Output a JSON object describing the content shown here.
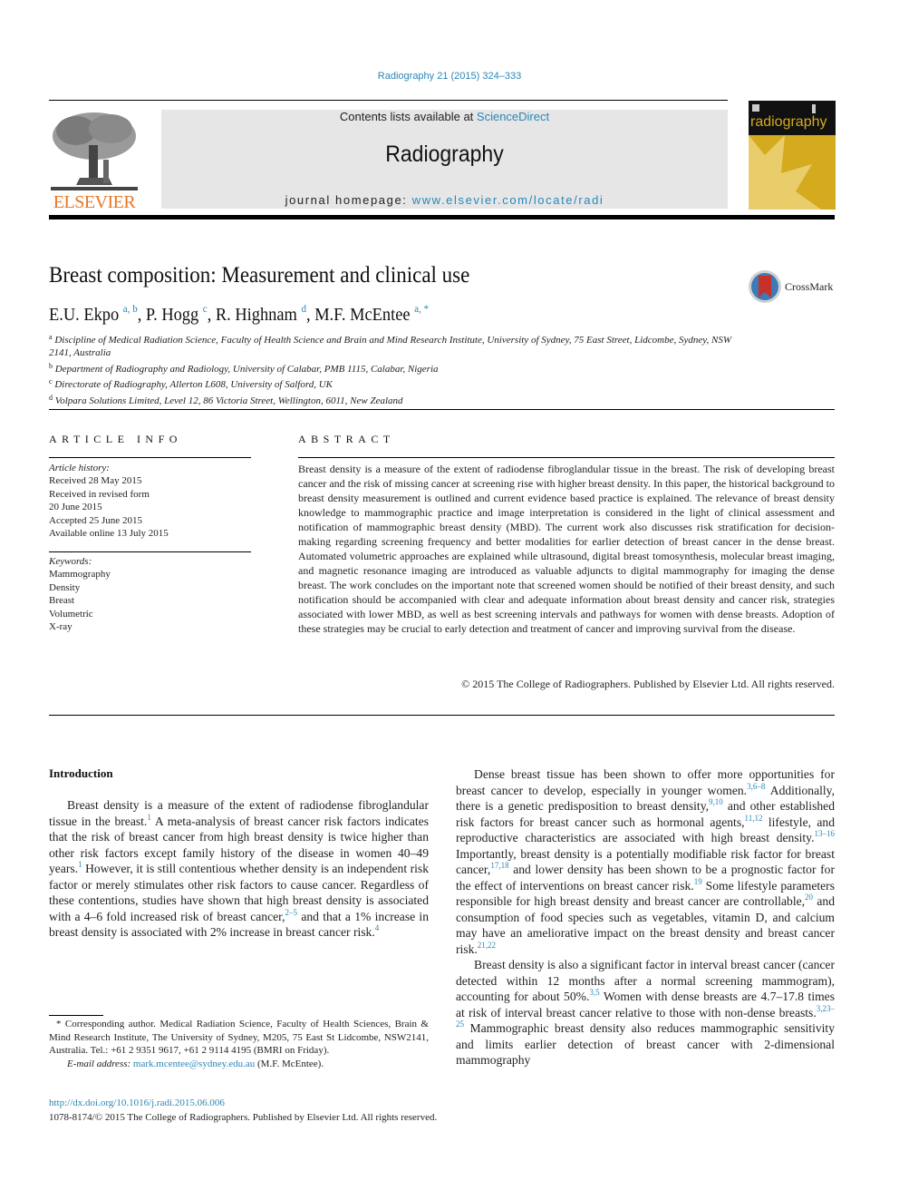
{
  "header": {
    "citation": "Radiography 21 (2015) 324–333",
    "contents_prefix": "Contents lists available at ",
    "contents_link": "ScienceDirect",
    "journal_name": "Radiography",
    "homepage_prefix": "journal homepage: ",
    "homepage_link": "www.elsevier.com/locate/radi",
    "publisher_logo_text": "ELSEVIER",
    "cover_title": "radiography",
    "crossmark_label": "CrossMark"
  },
  "article": {
    "title": "Breast composition: Measurement and clinical use",
    "authors": [
      {
        "name": "E.U. Ekpo",
        "affil": "a, b",
        "sep": ", "
      },
      {
        "name": "P. Hogg",
        "affil": "c",
        "sep": ", "
      },
      {
        "name": "R. Highnam",
        "affil": "d",
        "sep": ", "
      },
      {
        "name": "M.F. McEntee",
        "affil": "a, *",
        "sep": ""
      }
    ],
    "affiliations": [
      {
        "key": "a",
        "text": "Discipline of Medical Radiation Science, Faculty of Health Science and Brain and Mind Research Institute, University of Sydney, 75 East Street, Lidcombe, Sydney, NSW 2141, Australia"
      },
      {
        "key": "b",
        "text": "Department of Radiography and Radiology, University of Calabar, PMB 1115, Calabar, Nigeria"
      },
      {
        "key": "c",
        "text": "Directorate of Radiography, Allerton L608, University of Salford, UK"
      },
      {
        "key": "d",
        "text": "Volpara Solutions Limited, Level 12, 86 Victoria Street, Wellington, 6011, New Zealand"
      }
    ]
  },
  "article_info": {
    "heading": "ARTICLE INFO",
    "history_label": "Article history:",
    "history": [
      "Received 28 May 2015",
      "Received in revised form",
      "20 June 2015",
      "Accepted 25 June 2015",
      "Available online 13 July 2015"
    ],
    "keywords_label": "Keywords:",
    "keywords": [
      "Mammography",
      "Density",
      "Breast",
      "Volumetric",
      "X-ray"
    ]
  },
  "abstract": {
    "heading": "ABSTRACT",
    "text": "Breast density is a measure of the extent of radiodense fibroglandular tissue in the breast. The risk of developing breast cancer and the risk of missing cancer at screening rise with higher breast density. In this paper, the historical background to breast density measurement is outlined and current evidence based practice is explained. The relevance of breast density knowledge to mammographic practice and image interpretation is considered in the light of clinical assessment and notification of mammographic breast density (MBD). The current work also discusses risk stratification for decision-making regarding screening frequency and better modalities for earlier detection of breast cancer in the dense breast. Automated volumetric approaches are explained while ultrasound, digital breast tomosynthesis, mo­lecular breast imaging, and magnetic resonance imaging are introduced as valuable adjuncts to digital mammography for imaging the dense breast. The work concludes on the important note that screened women should be notified of their breast density, and such notification should be accompanied with clear and adequate information about breast density and cancer risk, strategies associated with lower MBD, as well as best screening intervals and pathways for women with dense breasts. Adoption of these strategies may be crucial to early detection and treatment of cancer and improving survival from the disease.",
    "copyright": "© 2015 The College of Radiographers. Published by Elsevier Ltd. All rights reserved."
  },
  "body": {
    "intro_heading": "Introduction",
    "left_paragraph": [
      {
        "t": "Breast density is a measure of the extent of radiodense fibroglandular tissue in the breast."
      },
      {
        "ref": "1"
      },
      {
        "t": " A meta-analysis of breast cancer risk factors indicates that the risk of breast cancer from high breast density is twice higher than other risk factors except family history of the disease in women 40–49 years."
      },
      {
        "ref": "1"
      },
      {
        "t": " However, it is still contentious whether density is an independent risk factor or merely stimulates other risk factors to cause cancer. Regardless of these contentions, studies have shown that high breast density is associated with a 4–6 fold increased risk of breast cancer,"
      },
      {
        "ref": "2–5"
      },
      {
        "t": " and that a 1% increase in breast density is associated with 2% increase in breast cancer risk."
      },
      {
        "ref": "4"
      }
    ],
    "right_paragraph_1": [
      {
        "t": "Dense breast tissue has been shown to offer more opportunities for breast cancer to develop, especially in younger women."
      },
      {
        "ref": "3,6–8"
      },
      {
        "t": " Additionally, there is a genetic predisposition to breast density,"
      },
      {
        "ref": "9,10"
      },
      {
        "t": " and other established risk factors for breast cancer such as hormonal agents,"
      },
      {
        "ref": "11,12"
      },
      {
        "t": " lifestyle, and reproductive characteristics are associated with high breast density."
      },
      {
        "ref": "13–16"
      },
      {
        "t": " Importantly, breast density is a potentially modifiable risk factor for breast cancer,"
      },
      {
        "ref": "17,18"
      },
      {
        "t": " and lower density has been shown to be a prognostic factor for the effect of interventions on breast cancer risk."
      },
      {
        "ref": "19"
      },
      {
        "t": " Some lifestyle parameters responsible for high breast density and breast cancer are controllable,"
      },
      {
        "ref": "20"
      },
      {
        "t": " and consumption of food species such as vegetables, vitamin D, and calcium may have an ameliorative impact on the breast density and breast cancer risk."
      },
      {
        "ref": "21,22"
      }
    ],
    "right_paragraph_2": [
      {
        "t": "Breast density is also a significant factor in interval breast cancer (cancer detected within 12 months after a normal screening mammogram), accounting for about 50%."
      },
      {
        "ref": "3,5"
      },
      {
        "t": " Women with dense breasts are 4.7–17.8 times at risk of interval breast cancer relative to those with non-dense breasts."
      },
      {
        "ref": "3,23–25"
      },
      {
        "t": " Mammographic breast density also reduces mammographic sensitivity and limits earlier detection of breast cancer with 2-dimensional mammography"
      }
    ]
  },
  "footnote": {
    "corresponding": "* Corresponding author. Medical Radiation Science, Faculty of Health Sciences, Brain & Mind Research Institute, The University of Sydney, M205, 75 East St Lidcombe, NSW2141, Australia. Tel.: +61 2 9351 9617, +61 2 9114 4195 (BMRI on Friday).",
    "email_label": "E-mail address:",
    "email": "mark.mcentee@sydney.edu.au",
    "email_suffix": " (M.F. McEntee).",
    "doi": "http://dx.doi.org/10.1016/j.radi.2015.06.006",
    "issn": "1078-8174/© 2015 The College of Radiographers. Published by Elsevier Ltd. All rights reserved."
  },
  "colors": {
    "link": "#2a87b8",
    "elsevier_orange": "#e87722",
    "cover_gold": "#d4aa1f",
    "masthead_gray": "#e6e6e6"
  }
}
